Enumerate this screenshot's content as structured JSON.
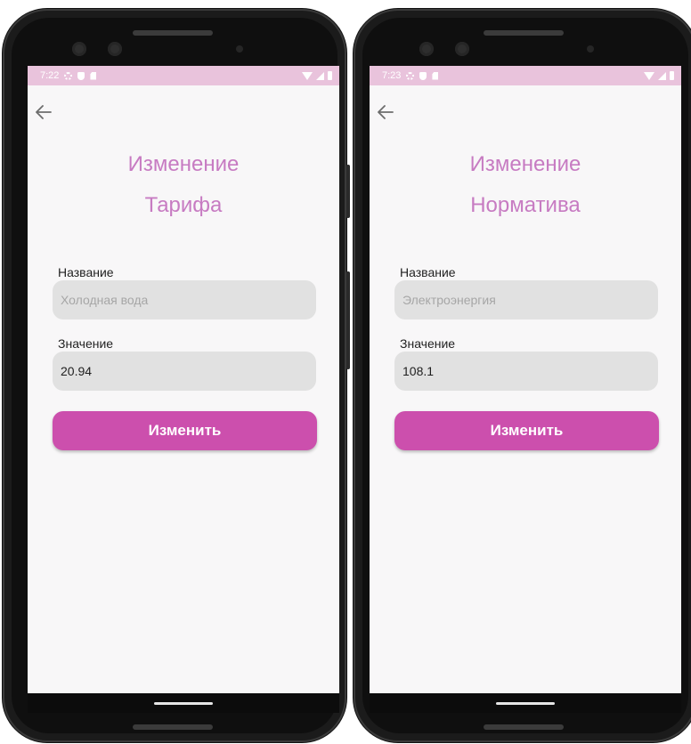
{
  "screens": [
    {
      "status": {
        "time": "7:22"
      },
      "title_line1": "Изменение",
      "title_line2": "Тарифа",
      "name_label": "Название",
      "name_placeholder": "Холодная вода",
      "value_label": "Значение",
      "value": "20.94",
      "button_label": "Изменить"
    },
    {
      "status": {
        "time": "7:23"
      },
      "title_line1": "Изменение",
      "title_line2": "Норматива",
      "name_label": "Название",
      "name_placeholder": "Электроэнергия",
      "value_label": "Значение",
      "value": "108.1",
      "button_label": "Изменить"
    }
  ],
  "colors": {
    "accent": "#cc4fad",
    "title": "#c77bc2",
    "statusbar": "#e9c3dc",
    "field_bg": "#e1e1e1",
    "screen_bg": "#f8f7f8"
  },
  "icons": [
    "arrow-back-icon",
    "gear-icon",
    "shield-icon",
    "sim-card-icon",
    "wifi-icon",
    "signal-icon",
    "battery-icon"
  ]
}
